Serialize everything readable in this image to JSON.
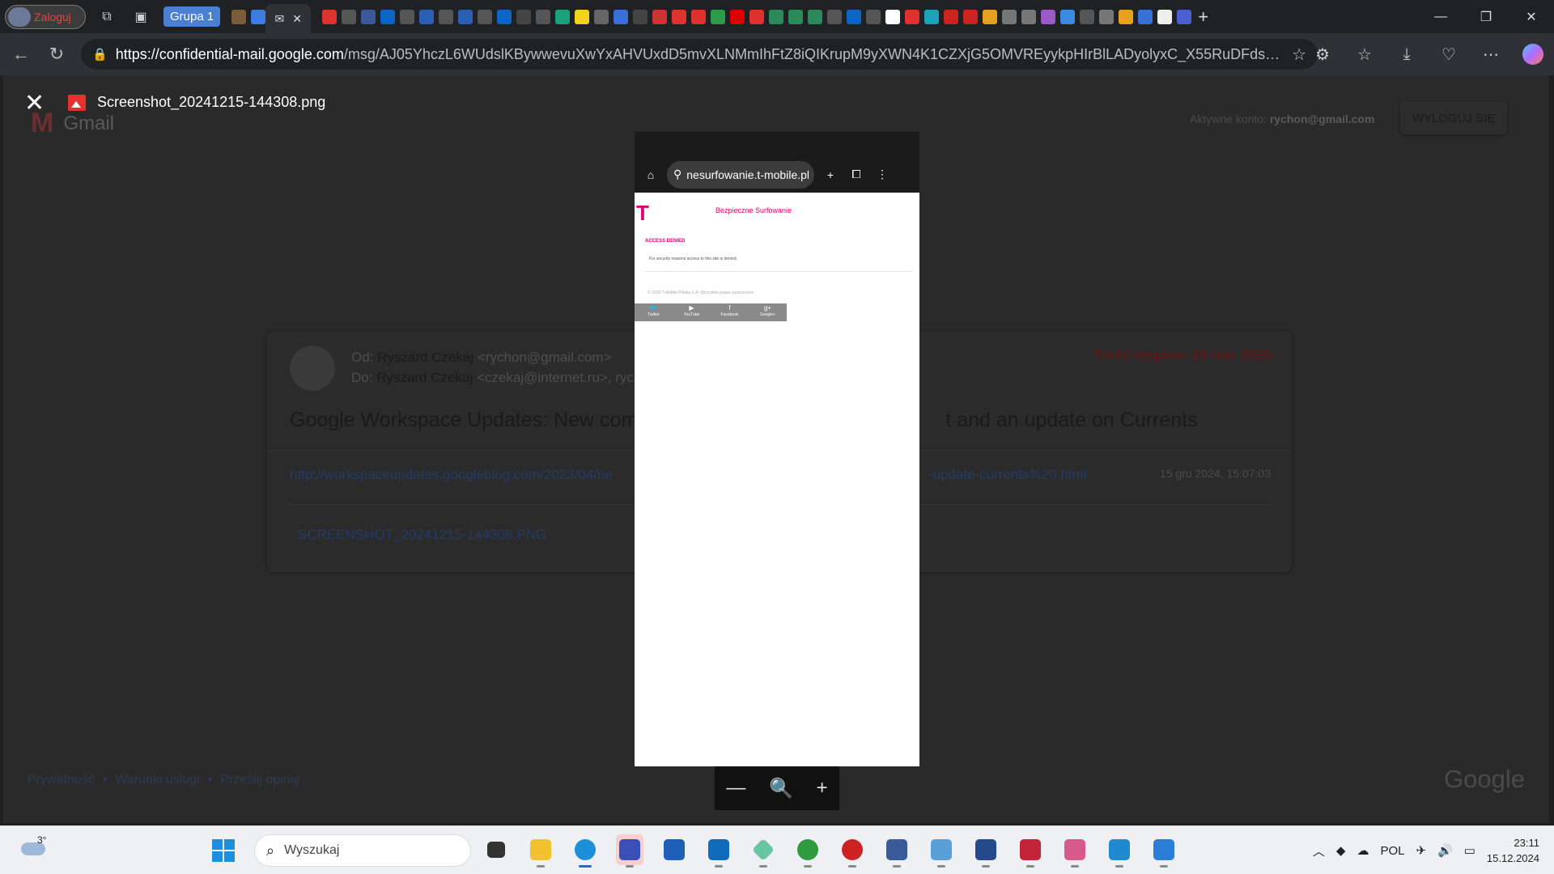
{
  "browser": {
    "profile_label": "Zaloguj",
    "tab_group_label": "Grupa 1",
    "url_host": "https://confidential-mail.google.com",
    "url_path": "/msg/AJ05YhczL6WUdslKBywwevuXwYxAHVUxdD5mvXLNMmIhFtZ8iQIKrupM9yXWN4K1CZXjG5OMVREyykpHIrBlLADyolyxC_X55RuDFdsAxCeMK2g..."
  },
  "viewer": {
    "file_name": "Screenshot_20241215-144308.png"
  },
  "gmail": {
    "logo_text": "Gmail",
    "account_label": "Aktywne konto:",
    "account_email": "rychon@gmail.com",
    "logout_label": "WYLOGUJ SIĘ",
    "from_prefix": "Od:",
    "from_name": "Ryszard Czekaj",
    "from_email": "<rychon@gmail.com>",
    "to_prefix": "Do:",
    "to_name": "Ryszard Czekaj",
    "to_email": "<czekaj@internet.ru>, ryc",
    "expire_text": "Treść wygasa: 15 mar 2025",
    "subject_left": "Google Workspace Updates: New com",
    "subject_right": "t and an update on Currents",
    "link_left": "http://workspaceupdates.googleblog.com/2023/04/ne",
    "link_right": "-update-currents%20.html",
    "date": "15 gru 2024, 15:07:03",
    "attachment": "SCREENSHOT_20241215-144308.PNG",
    "footer_links": [
      "Prywatność",
      "Warunki usługi",
      "Prześlij opinię"
    ],
    "footer_brand": "Google"
  },
  "phone_shot": {
    "url_text": "nesurfowanie.t-mobile.pl",
    "logo": "T",
    "header_title": "Bezpieczne Surfowanie",
    "denied_title": "ACCESS DENIED",
    "denied_message": "For security reasons access to this site is denied.",
    "copyright": "© 2018 T-Mobile Polska S.A. Wszystkie prawa zastrzeżone",
    "social": [
      "Twitter",
      "YouTube",
      "Facebook",
      "Google+"
    ]
  },
  "taskbar": {
    "weather_temp": "3°",
    "search_placeholder": "Wyszukaj",
    "language": "POL",
    "time": "23:11",
    "date": "15.12.2024"
  },
  "colors": {
    "accent_tmobile": "#e20074",
    "tab_group": "#4a7fd1",
    "expire_text": "#5a1a1a"
  }
}
